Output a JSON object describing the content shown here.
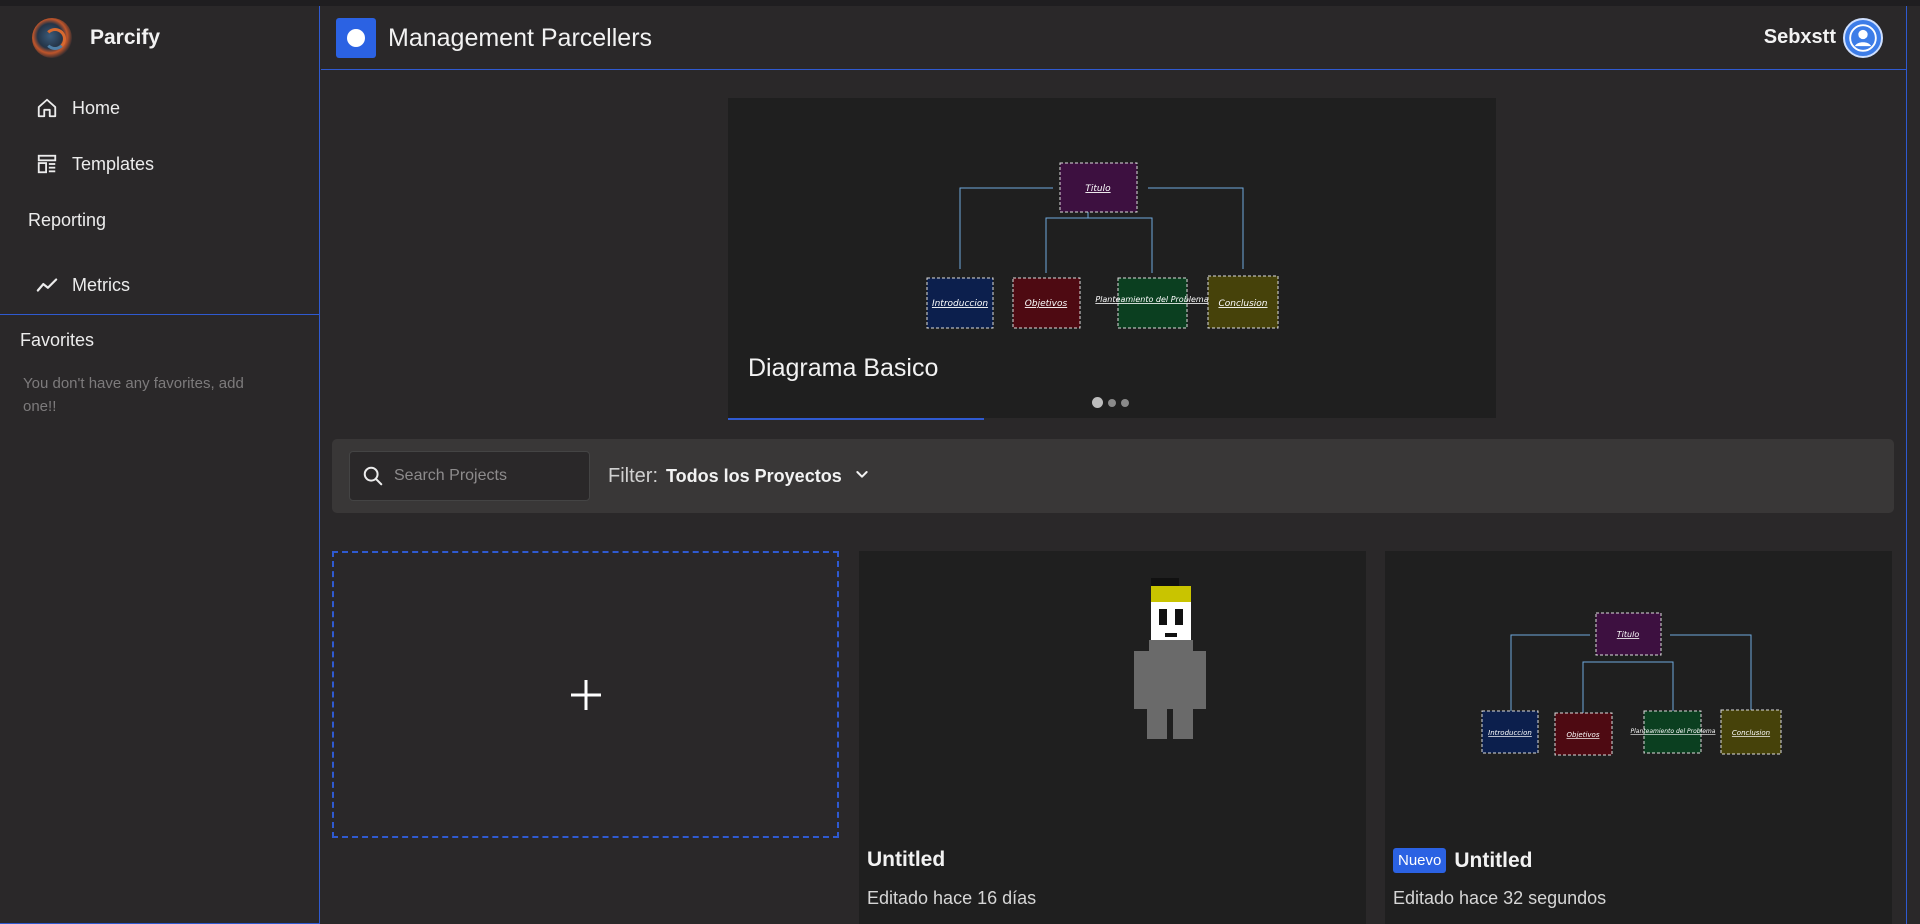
{
  "app": {
    "name": "Parcify"
  },
  "sidebar": {
    "nav": [
      {
        "label": "Home",
        "icon": "home-icon"
      },
      {
        "label": "Templates",
        "icon": "templates-icon"
      }
    ],
    "section_reporting": "Reporting",
    "metrics": {
      "label": "Metrics",
      "icon": "metrics-icon"
    },
    "favorites_title": "Favorites",
    "favorites_empty": "You don't have any favorites, add one!!"
  },
  "header": {
    "title": "Management Parcellers",
    "user": "Sebxstt"
  },
  "carousel": {
    "title": "Diagrama Basico",
    "slide_count": 3,
    "active_index": 0,
    "diagram": {
      "root": "Titulo",
      "children": [
        "Introduccion",
        "Objetivos",
        "Planteamiento del Problema",
        "Conclusion"
      ]
    }
  },
  "toolbar": {
    "search_placeholder": "Search Projects",
    "filter_label": "Filter:",
    "filter_value": "Todos los Proyectos"
  },
  "projects": [
    {
      "title": "Untitled",
      "edited": "Editado hace 16 días",
      "badge": "",
      "thumbnail": "pixel-character"
    },
    {
      "title": "Untitled",
      "edited": "Editado hace 32 segundos",
      "badge": "Nuevo",
      "thumbnail": "diagram"
    }
  ],
  "colors": {
    "accent": "#2b62e3",
    "background": "#2a2829",
    "panel": "#1f1f1f",
    "node_titulo": "#3d1040",
    "node_introduccion": "#0c1f4d",
    "node_objetivos": "#4e0a12",
    "node_planteamiento": "#0b3f20",
    "node_conclusion": "#46420a"
  }
}
